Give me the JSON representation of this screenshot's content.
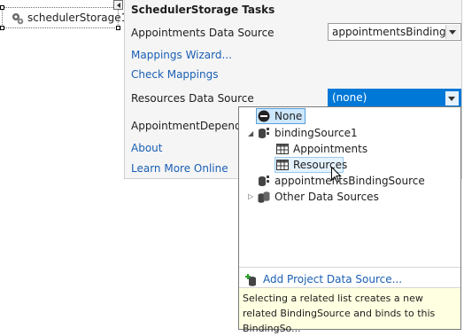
{
  "component": {
    "name": "schedulerStorage1",
    "icon": "scheduler-storage-icon"
  },
  "panel": {
    "title": "SchedulerStorage Tasks",
    "appointments_label": "Appointments  Data Source",
    "appointments_value": "appointmentsBindingS",
    "mappings_wizard": "Mappings Wizard...",
    "check_mappings": "Check Mappings",
    "resources_label": "Resources  Data Source",
    "resources_value": "(none)",
    "appointment_dependency_label": "AppointmentDependen",
    "about": "About",
    "learn_more": "Learn More Online"
  },
  "dropdown": {
    "items": [
      {
        "label": "None",
        "icon": "none-icon",
        "selected": true
      },
      {
        "label": "bindingSource1",
        "icon": "binding-source-icon",
        "expanded": true
      },
      {
        "label": "Appointments",
        "icon": "table-icon"
      },
      {
        "label": "Resources",
        "icon": "table-icon",
        "hovered": true
      },
      {
        "label": "appointmentsBindingSource",
        "icon": "binding-source-icon"
      },
      {
        "label": "Other Data Sources",
        "icon": "data-sources-icon",
        "expanded": false
      }
    ],
    "add_link": "Add Project Data Source...",
    "hint": "Selecting a related list creates a new related BindingSource and binds to this BindingSo..."
  },
  "colors": {
    "accent": "#0078d7",
    "link": "#1a5fb4",
    "panel_bg": "#f5f5f5",
    "hint_bg": "#ffffe1"
  }
}
